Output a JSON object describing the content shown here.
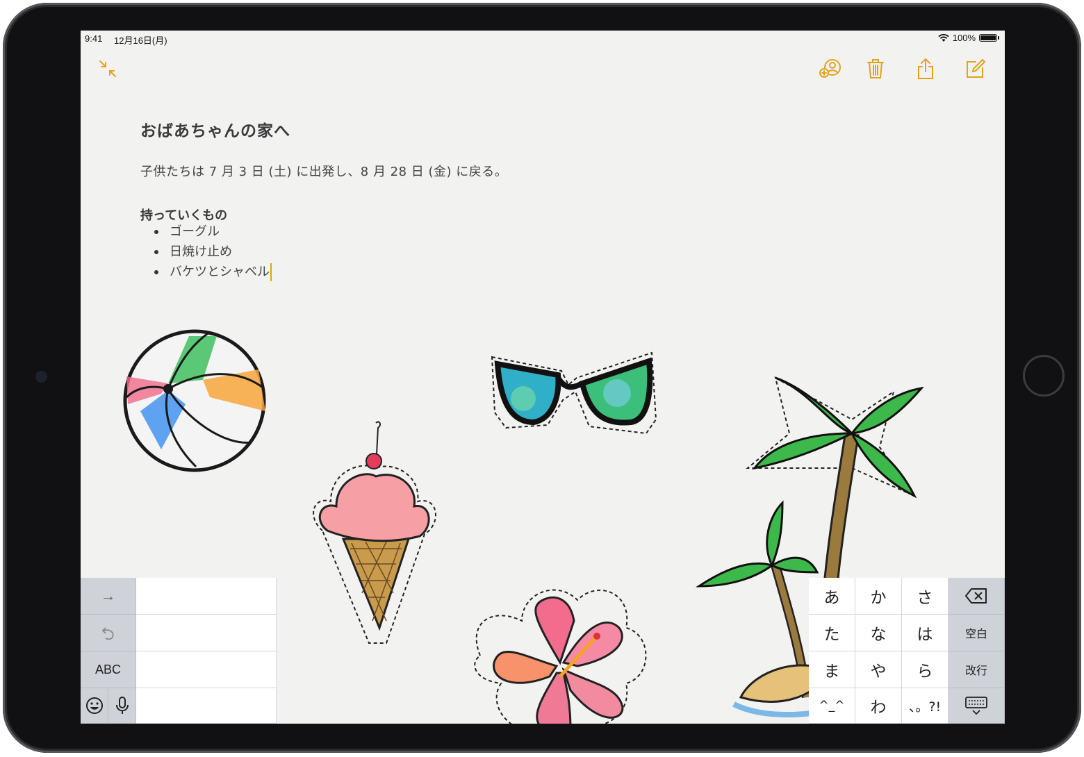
{
  "status_bar": {
    "time": "9:41",
    "date": "12月16日(月)",
    "battery": "100%",
    "wifi_icon": "wifi-icon",
    "battery_icon": "battery-icon"
  },
  "toolbar": {
    "accent_color": "#e3a21a",
    "icons": [
      "collapse-icon",
      "add-person-icon",
      "trash-icon",
      "share-icon",
      "compose-icon"
    ]
  },
  "note": {
    "title": "おばあちゃんの家へ",
    "body": "子供たちは 7 月 3 日 (土) に出発し、8 月 28 日 (金) に戻る。",
    "list_heading": "持っていくもの",
    "list_items": [
      "ゴーグル",
      "日焼け止め",
      "バケツとシャベル"
    ]
  },
  "stickers": [
    "beach-ball",
    "sunglasses",
    "ice-cream",
    "palm-trees",
    "hibiscus-flower"
  ],
  "keyboard_left": {
    "tab_arrow": "→",
    "undo_icon": "undo-icon",
    "abc_label": "ABC",
    "emoji_icon": "emoji-icon",
    "mic_icon": "microphone-icon"
  },
  "keyboard_right": {
    "rows": [
      [
        "あ",
        "か",
        "さ"
      ],
      [
        "た",
        "な",
        "は"
      ],
      [
        "ま",
        "や",
        "ら"
      ],
      [
        "^_^",
        "わ",
        "、。?!"
      ]
    ],
    "delete_icon": "delete-icon",
    "space_label": "空白",
    "return_label": "改行",
    "dismiss_icon": "keyboard-dismiss-icon"
  }
}
